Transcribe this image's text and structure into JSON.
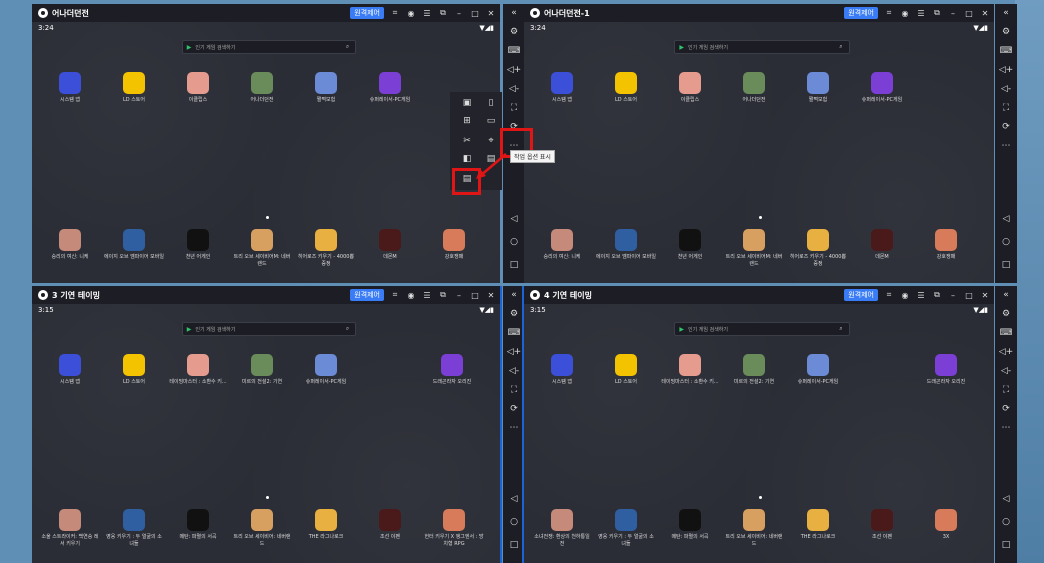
{
  "windows": [
    {
      "title": "어나더던전",
      "time": "3:24",
      "remote_label": "원격제어",
      "search_placeholder": "인기 게임 검색하기",
      "row1": [
        "시스템 앱",
        "LD 스토어",
        "이클립스",
        "어나더던전",
        "쩔쩍모험",
        "슈퍼레이서-PC게임"
      ],
      "row2": [
        "승리의 여신: 니케",
        "에이지 오브 엠파이어 모바일",
        "천년 어게인",
        "트리 오브 세이비어M: 네버랜드",
        "히어로즈 키우기 - 4000뽑 증정",
        "데몬M",
        "강호쟁패"
      ]
    },
    {
      "title": "어나더던전-1",
      "time": "3:24",
      "remote_label": "원격제어",
      "search_placeholder": "인기 게임 검색하기",
      "row1": [
        "시스템 앱",
        "LD 스토어",
        "이클립스",
        "어나더던전",
        "쩔쩍모험",
        "슈퍼레이서-PC게임"
      ],
      "row2": [
        "승리의 여신: 니케",
        "에이지 오브 엠파이어 모바일",
        "천년 어게인",
        "트리 오브 세이비어M: 네버랜드",
        "히어로즈 키우기 - 4000뽑 증정",
        "데몬M",
        "강호쟁패"
      ]
    },
    {
      "title": "3 기연 테이밍",
      "time": "3:15",
      "remote_label": "원격제어",
      "search_placeholder": "인기 게임 검색하기",
      "row1": [
        "시스템 앱",
        "LD 스토어",
        "테이밍마스터 : 소환수 키...",
        "미르의 전설2: 기연",
        "슈퍼레이서-PC게임",
        "드래곤라자 오리진"
      ],
      "row2": [
        "소울 스트라이커: 백연승 레서 키우기",
        "영웅 키우기 : 두 얼굴의 소녀들",
        "메탄: 파멸의 서곡",
        "트리 오브 세이비어: 네버랜드",
        "THE 라그나로크",
        "조선 이펜",
        "헌터 키우기 X 앵그엔서 : 방치형 RPG"
      ]
    },
    {
      "title": "4 기연 테이밍",
      "time": "3:15",
      "remote_label": "원격제어",
      "search_placeholder": "인기 게임 검색하기",
      "row1": [
        "시스템 앱",
        "LD 스토어",
        "테이밍마스터 : 소환수 키...",
        "미르의 전설2: 기연",
        "슈퍼레이서-PC게임",
        "드래곤라자 오리진"
      ],
      "row2": [
        "소녀전쟁: 환상의 천하통일 전",
        "영웅 키우기 : 두 얼굴의 소녀들",
        "메탄: 파멸의 서곡",
        "트리 오브 세이비어: 네버랜드",
        "THE 라그나로크",
        "조선 이펜",
        "3X"
      ]
    }
  ],
  "tooltip": "작업 옵션 표시",
  "colors": {
    "accent": "#3a7cf5",
    "highlight": "#e01515",
    "titlebar": "#1d1e25",
    "screen_bg": "#2b2d36"
  },
  "icons": {
    "titlebar": [
      "gamepad-icon",
      "account-icon",
      "menu-icon",
      "minimize-window-icon",
      "minimize-icon",
      "maximize-icon",
      "close-icon"
    ],
    "sidebar": [
      "collapse-icon",
      "settings-icon",
      "keyboard-icon",
      "volume-up-icon",
      "volume-down-icon",
      "fullscreen-icon",
      "rotate-icon",
      "more-options-icon",
      "back-icon",
      "home-icon",
      "recent-apps-icon"
    ]
  }
}
